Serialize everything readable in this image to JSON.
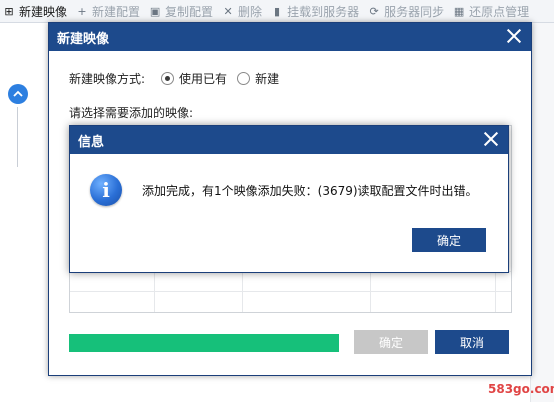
{
  "toolbar": {
    "items": [
      {
        "label": "新建映像",
        "icon": "plus-box-icon"
      },
      {
        "label": "新建配置",
        "icon": "plus-icon"
      },
      {
        "label": "复制配置",
        "icon": "copy-icon"
      },
      {
        "label": "删除",
        "icon": "x-icon"
      },
      {
        "label": "挂载到服务器",
        "icon": "mount-icon"
      },
      {
        "label": "服务器同步",
        "icon": "sync-icon"
      },
      {
        "label": "还原点管理",
        "icon": "calendar-icon"
      }
    ]
  },
  "dialog": {
    "title": "新建映像",
    "mode_label": "新建映像方式:",
    "mode_options": [
      "使用已有",
      "新建"
    ],
    "selected_mode": "使用已有",
    "select_label": "请选择需要添加的映像:",
    "progress_percent": 100,
    "ok_label": "确定",
    "cancel_label": "取消"
  },
  "info_dialog": {
    "title": "信息",
    "message": "添加完成，有1个映像添加失败：(3679)读取配置文件时出错。",
    "ok_label": "确定",
    "icon": "info-icon"
  },
  "watermark": "583go.com",
  "colors": {
    "titlebar": "#1d4a8c",
    "progress": "#16c07a",
    "disabled_button": "#c7c7c7"
  }
}
